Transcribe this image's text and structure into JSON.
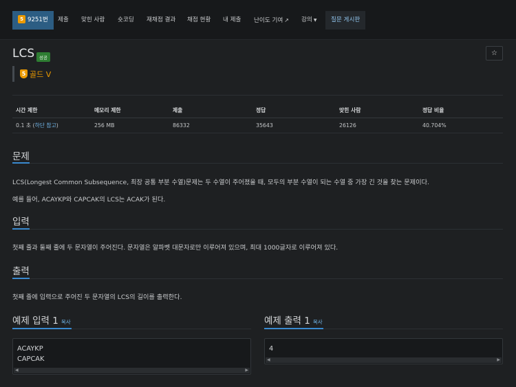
{
  "nav": {
    "problem_number": "9251번",
    "items": [
      "제출",
      "맞힌 사람",
      "숏코딩",
      "재채점 결과",
      "채점 현황",
      "내 제출",
      "난이도 기여",
      "강의",
      "질문 게시판"
    ],
    "badge_digit": "5"
  },
  "problem": {
    "title": "LCS",
    "status_label": "성공",
    "tier_digit": "5",
    "tier": "골드 V",
    "star": "☆"
  },
  "info_table": {
    "headers": [
      "시간 제한",
      "메모리 제한",
      "제출",
      "정답",
      "맞힌 사람",
      "정답 비율"
    ],
    "time_limit": "0.1 초 (",
    "time_limit_link": "하단 참고",
    "time_limit_close": ")",
    "memory_limit": "256 MB",
    "submissions": "86332",
    "accepted": "35643",
    "solvers": "26126",
    "ratio": "40.704%"
  },
  "sections": {
    "problem_title": "문제",
    "problem_p1": "LCS(Longest Common Subsequence, 최장 공통 부분 수열)문제는 두 수열이 주어졌을 때, 모두의 부분 수열이 되는 수열 중 가장 긴 것을 찾는 문제이다.",
    "problem_p2": "예를 들어, ACAYKP와 CAPCAK의 LCS는 ACAK가 된다.",
    "input_title": "입력",
    "input_p": "첫째 줄과 둘째 줄에 두 문자열이 주어진다. 문자열은 알파벳 대문자로만 이루어져 있으며, 최대 1000글자로 이루어져 있다.",
    "output_title": "출력",
    "output_p": "첫째 줄에 입력으로 주어진 두 문자열의 LCS의 길이를 출력한다."
  },
  "examples": {
    "input_title": "예제 입력 1",
    "output_title": "예제 출력 1",
    "copy_label": "복사",
    "input_text": "ACAYKP\nCAPCAK",
    "output_text": "4"
  }
}
